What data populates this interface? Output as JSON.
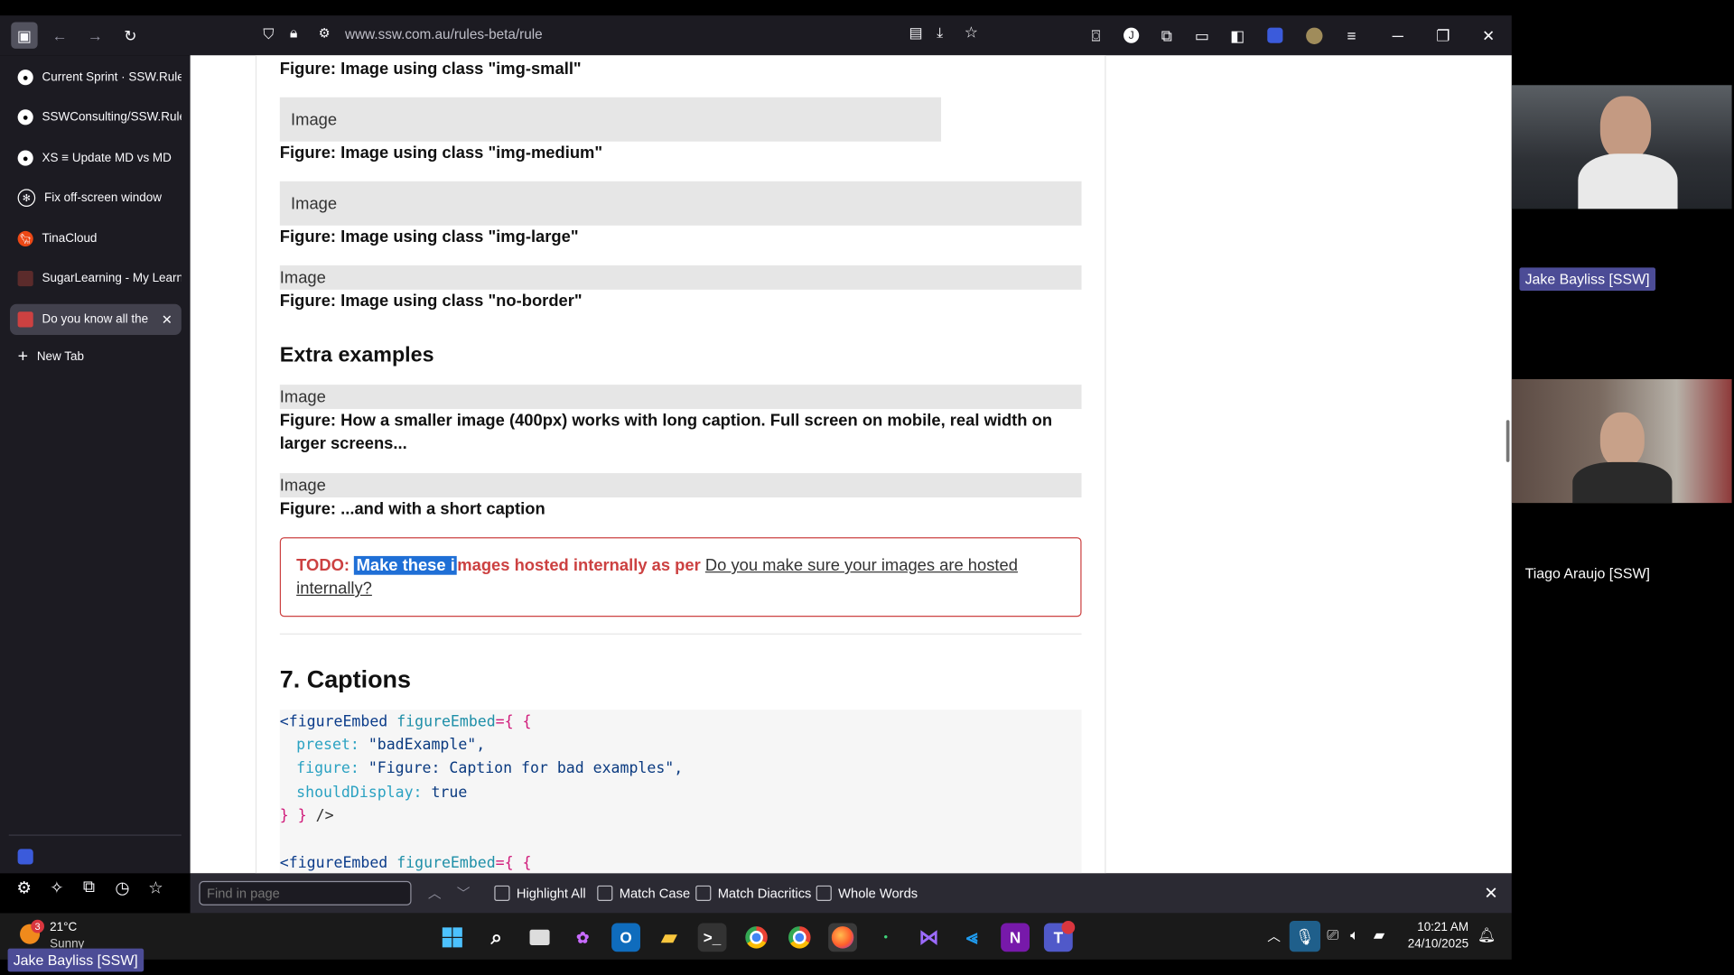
{
  "browser": {
    "url": "www.ssw.com.au/rules-beta/rule",
    "tabs": [
      {
        "label": "Current Sprint · SSW.Rule",
        "icon": "github-icon"
      },
      {
        "label": "SSWConsulting/SSW.Rule",
        "icon": "github-icon"
      },
      {
        "label": "XS  ≡  Update MD vs MD",
        "icon": "github-icon"
      },
      {
        "label": "Fix off-screen window",
        "icon": "openai-icon"
      },
      {
        "label": "TinaCloud",
        "icon": "tina-icon"
      },
      {
        "label": "SugarLearning - My Learn",
        "icon": "sugar-icon"
      },
      {
        "label": "Do you know all the",
        "icon": "ssw-icon",
        "active": true
      }
    ],
    "new_tab": "New Tab"
  },
  "content": {
    "cap_small": "Figure: Image using class \"img-small\"",
    "img_medium": "Image",
    "cap_medium": "Figure: Image using class \"img-medium\"",
    "img_large": "Image",
    "cap_large": "Figure: Image using class \"img-large\"",
    "img_noborder": "Image",
    "cap_noborder": "Figure: Image using class \"no-border\"",
    "extra_heading": "Extra examples",
    "img_extra1": "Image",
    "cap_extra1": "Figure: How a smaller image (400px) works with long caption. Full screen on mobile, real width on larger screens...",
    "img_extra2": "Image",
    "cap_extra2": "Figure: ...and with a short caption",
    "todo_prefix": "TODO:",
    "todo_highlight": "Make these i",
    "todo_rest": "mages hosted internally as per",
    "todo_link": "Do you make sure your images are hosted internally?",
    "section_heading": "7. Captions",
    "code": {
      "l1_tag": "<figureEmbed",
      "l1_attr": "figureEmbed",
      "l1_eq": "={ {",
      "l2_key": "preset:",
      "l2_val": "\"badExample\",",
      "l3_key": "figure:",
      "l3_val_a": "\"Figure:",
      "l3_val_b": "Caption for bad examples\",",
      "l4_key": "shouldDisplay:",
      "l4_val": "true",
      "l5_close": "} }",
      "l5_end": "/>",
      "l7_tag": "<figureEmbed",
      "l7_attr": "figureEmbed",
      "l7_eq": "={ {"
    }
  },
  "findbar": {
    "placeholder": "Find in page",
    "options": [
      "Highlight All",
      "Match Case",
      "Match Diacritics",
      "Whole Words"
    ]
  },
  "taskbar": {
    "weather_temp": "21°C",
    "weather_desc": "Sunny",
    "weather_badge": "3",
    "time": "10:21 AM",
    "date": "24/10/2025",
    "presenter": "Jake Bayliss [SSW]"
  },
  "participants": [
    {
      "name": "Jake Bayliss [SSW]"
    },
    {
      "name": "Tiago Araujo [SSW]"
    }
  ],
  "colors": {
    "todo_red": "#cc4141",
    "highlight_blue": "#1f6fd6",
    "badge_purple": "#4c4c96"
  }
}
